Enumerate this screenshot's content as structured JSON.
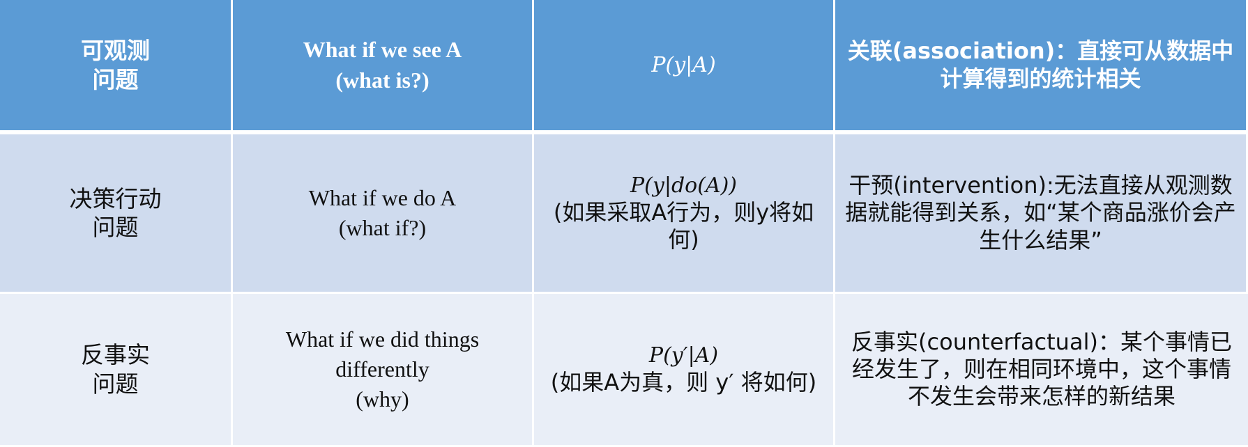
{
  "header": {
    "category": [
      "可观测",
      "问题"
    ],
    "question": [
      "What if we see A",
      "(what is?)"
    ],
    "formula": "P(y|A)",
    "description": "关联(association)：直接可从数据中计算得到的统计相关"
  },
  "rows": [
    {
      "category": [
        "决策行动",
        "问题"
      ],
      "question": [
        "What if we do A",
        "(what if?)"
      ],
      "formula": "P(y|do(A))",
      "formula_note": "(如果采取A行为，则y将如何)",
      "description": "干预(intervention):无法直接从观测数据就能得到关系，如“某个商品涨价会产生什么结果”"
    },
    {
      "category": [
        "反事实",
        "问题"
      ],
      "question": [
        "What if we did things differently",
        "(why)"
      ],
      "formula": "P(y′|A)",
      "formula_note": "(如果A为真，则 y′ 将如何)",
      "description": "反事实(counterfactual)：某个事情已经发生了，则在相同环境中，这个事情不发生会带来怎样的新结果"
    }
  ]
}
